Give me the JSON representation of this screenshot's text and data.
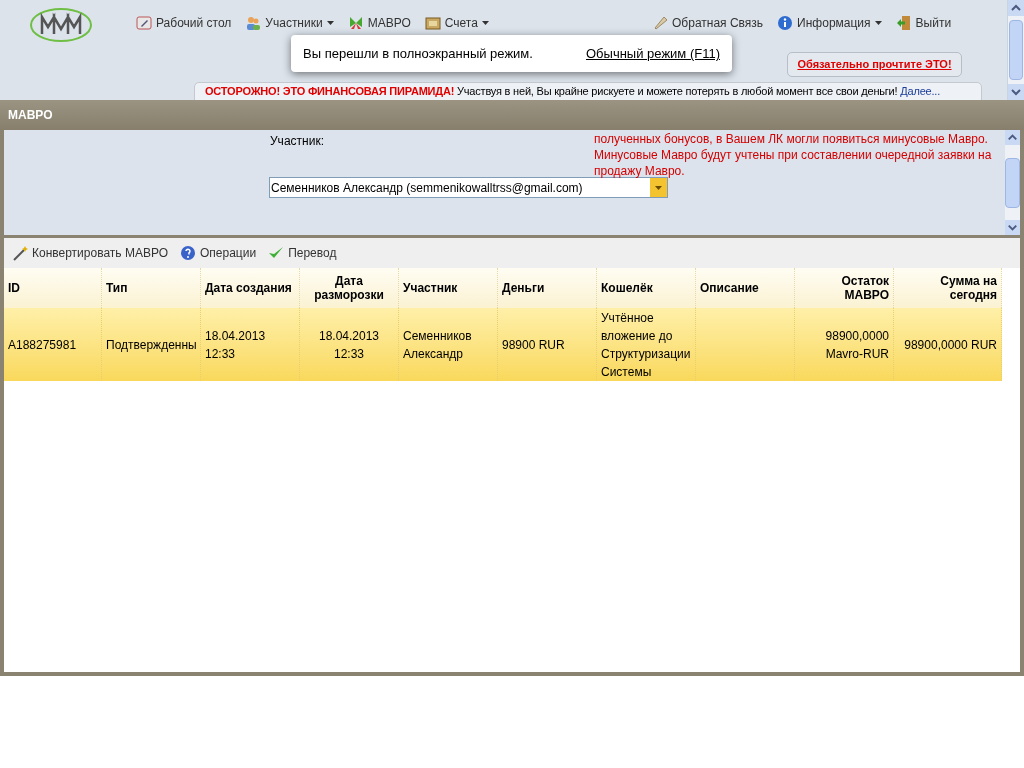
{
  "nav": {
    "left": [
      {
        "label": "Рабочий стол",
        "dropdown": false
      },
      {
        "label": "Участники",
        "dropdown": true
      },
      {
        "label": "МАВРО",
        "dropdown": false
      },
      {
        "label": "Счета",
        "dropdown": true
      }
    ],
    "right": [
      {
        "label": "Обратная Связь",
        "dropdown": false
      },
      {
        "label": "Информация",
        "dropdown": true
      },
      {
        "label": "Выйти",
        "dropdown": false
      }
    ]
  },
  "fullscreen_popup": {
    "message": "Вы перешли в полноэкранный режим.",
    "link": "Обычный режим (F11)"
  },
  "read_this_button": "Обязательно прочтите ЭТО!",
  "warning": {
    "alert": "ОСТОРОЖНО! ЭТО ФИНАНСОВАЯ ПИРАМИДА!",
    "text": "Участвуя в ней, Вы крайне рискуете и можете потерять в любой момент все свои деньги!",
    "link": "Далее..."
  },
  "panel": {
    "title": "МАВРО",
    "participant_label": "Участник:",
    "participant_value": "Семенников Александр (semmenikowalltrss@gmail.com)",
    "notice": "полученных бонусов, в Вашем ЛК могли появиться минусовые Мавро. Минусовые Мавро будут учтены при составлении очередной заявки на продажу Мавро."
  },
  "toolbar": [
    {
      "label": "Конвертировать МАВРО"
    },
    {
      "label": "Операции"
    },
    {
      "label": "Перевод"
    }
  ],
  "table": {
    "columns": [
      {
        "label": "ID"
      },
      {
        "label": "Тип"
      },
      {
        "label": "Дата создания"
      },
      {
        "label": "Дата разморозки"
      },
      {
        "label": "Участник"
      },
      {
        "label": "Деньги"
      },
      {
        "label": "Кошелёк"
      },
      {
        "label": "Описание"
      },
      {
        "label": "Остаток МАВРО"
      },
      {
        "label": "Сумма на сегодня"
      }
    ],
    "rows": [
      {
        "selected": true,
        "cells": [
          "A188275981",
          "Подтвержденны",
          "18.04.2013 12:33",
          "18.04.2013 12:33",
          "Семенников Александр",
          "98900 RUR",
          "Учтённое вложение до Структуризации Системы",
          "",
          "98900,0000 Mavro-RUR",
          "98900,0000 RUR"
        ]
      }
    ]
  }
}
